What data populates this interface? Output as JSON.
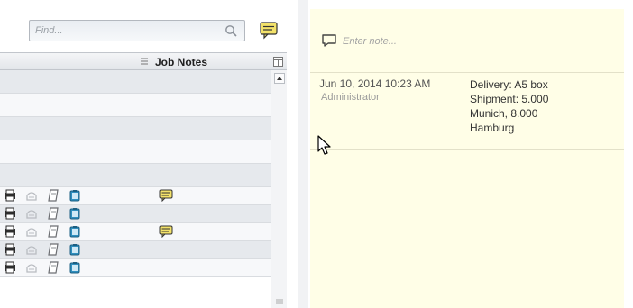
{
  "search": {
    "placeholder": "Find..."
  },
  "grid": {
    "column_job_notes": "Job Notes",
    "rows": [
      {
        "has_actions": false,
        "has_note": false
      },
      {
        "has_actions": false,
        "has_note": false
      },
      {
        "has_actions": false,
        "has_note": false
      },
      {
        "has_actions": false,
        "has_note": false
      },
      {
        "has_actions": false,
        "has_note": false
      },
      {
        "has_actions": true,
        "has_note": true
      },
      {
        "has_actions": true,
        "has_note": false
      },
      {
        "has_actions": true,
        "has_note": true
      },
      {
        "has_actions": true,
        "has_note": false
      },
      {
        "has_actions": true,
        "has_note": false
      }
    ],
    "row_icons": [
      "print-icon",
      "mail-icon",
      "document-icon",
      "clipboard-icon"
    ]
  },
  "notes": {
    "input_placeholder": "Enter note...",
    "entries": [
      {
        "date": "Jun 10, 2014 10:23 AM",
        "author": "Administrator",
        "lines": [
          "Delivery: A5 box",
          "Shipment: 5.000",
          "Munich, 8.000",
          "Hamburg"
        ]
      }
    ]
  },
  "colors": {
    "notes_background": "#fffee7",
    "grid_row_shaded": "#e6e9ed",
    "grid_row_plain": "#f7f8fa",
    "note_icon_fill": "#f3e26a",
    "clipboard_icon": "#2f8fbf"
  }
}
